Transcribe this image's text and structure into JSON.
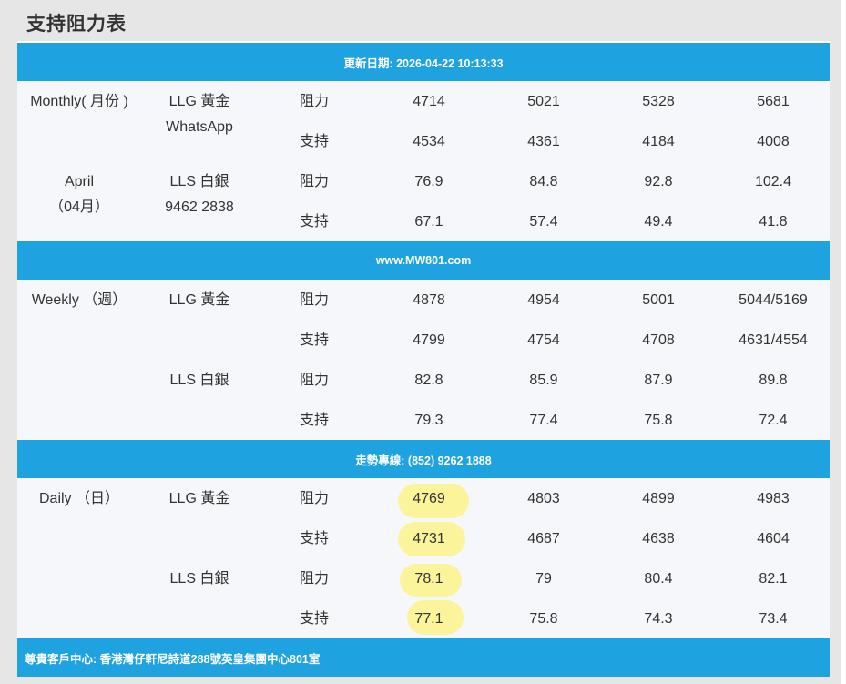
{
  "title": "支持阻力表",
  "bands": {
    "update": "更新日期: 2026-04-22 10:13:33",
    "website": "www.MW801.com",
    "hotline": "走勢專線: (852) 9262 1888",
    "address": "尊貴客戶中心: 香港灣仔軒尼詩道288號英皇集團中心801室"
  },
  "monthly": {
    "period_label": "Monthly( 月份 )",
    "month_label": "April",
    "month_sub": "（04月）",
    "contact_label": "WhatsApp",
    "contact_number": "9462 2838",
    "llg": {
      "name": "LLG 黃金",
      "resistance": {
        "label": "阻力",
        "values": [
          "4714",
          "5021",
          "5328",
          "5681"
        ]
      },
      "support": {
        "label": "支持",
        "values": [
          "4534",
          "4361",
          "4184",
          "4008"
        ]
      }
    },
    "lls": {
      "name": "LLS 白銀",
      "resistance": {
        "label": "阻力",
        "values": [
          "76.9",
          "84.8",
          "92.8",
          "102.4"
        ]
      },
      "support": {
        "label": "支持",
        "values": [
          "67.1",
          "57.4",
          "49.4",
          "41.8"
        ]
      }
    }
  },
  "weekly": {
    "period_label": "Weekly （週）",
    "llg": {
      "name": "LLG 黃金",
      "resistance": {
        "label": "阻力",
        "values": [
          "4878",
          "4954",
          "5001",
          "5044/5169"
        ]
      },
      "support": {
        "label": "支持",
        "values": [
          "4799",
          "4754",
          "4708",
          "4631/4554"
        ]
      }
    },
    "lls": {
      "name": "LLS 白銀",
      "resistance": {
        "label": "阻力",
        "values": [
          "82.8",
          "85.9",
          "87.9",
          "89.8"
        ]
      },
      "support": {
        "label": "支持",
        "values": [
          "79.3",
          "77.4",
          "75.8",
          "72.4"
        ]
      }
    }
  },
  "daily": {
    "period_label": "Daily （日）",
    "llg": {
      "name": "LLG 黃金",
      "resistance": {
        "label": "阻力",
        "values": [
          "4769",
          "4803",
          "4899",
          "4983"
        ]
      },
      "support": {
        "label": "支持",
        "values": [
          "4731",
          "4687",
          "4638",
          "4604"
        ]
      }
    },
    "lls": {
      "name": "LLS 白銀",
      "resistance": {
        "label": "阻力",
        "values": [
          "78.1",
          "79",
          "80.4",
          "82.1"
        ]
      },
      "support": {
        "label": "支持",
        "values": [
          "77.1",
          "75.8",
          "74.3",
          "73.4"
        ]
      }
    }
  },
  "highlight_color": "#fbf49b",
  "band_color": "#1ea2e0"
}
